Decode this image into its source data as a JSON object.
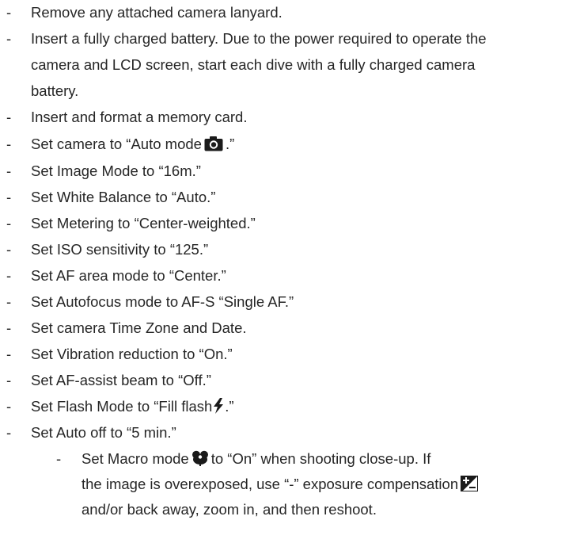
{
  "bullet": "-",
  "items": {
    "lanyard": "Remove any attached camera lanyard.",
    "battery_1": "Insert a fully charged battery. Due to the power required to operate the",
    "battery_2": "camera and LCD screen, start each dive with a fully charged camera",
    "battery_3": "battery.",
    "memory": "Insert and format a memory card.",
    "auto_mode_pre": "Set camera to “Auto mode",
    "auto_mode_post": ".”",
    "image_mode": "Set Image Mode to “16m.”",
    "white_balance": "Set White Balance to “Auto.”",
    "metering": "Set Metering to “Center-weighted.”",
    "iso": "Set ISO sensitivity to “125.”",
    "af_area": "Set AF area mode to “Center.”",
    "autofocus": "Set Autofocus mode to AF-S “Single AF.”",
    "timezone": "Set camera Time Zone and Date.",
    "vibration": "Set Vibration reduction to “On.”",
    "af_assist": "Set AF-assist beam to “Off.”",
    "flash_pre": "Set Flash Mode to “Fill flash",
    "flash_post": ".”",
    "auto_off": "Set Auto off to “5 min.”",
    "macro_1_pre": "Set Macro mode",
    "macro_1_post": "to “On” when shooting close-up. If",
    "macro_2_pre": "the image is overexposed, use “-” exposure compensation",
    "macro_3": "and/or back away, zoom in, and then reshoot."
  },
  "icons": {
    "auto_mode": "camera-icon",
    "flash": "flash-icon",
    "macro": "macro-flower-icon",
    "exposure": "exposure-compensation-icon"
  },
  "colors": {
    "text": "#262626",
    "icon": "#1a1a1a"
  }
}
